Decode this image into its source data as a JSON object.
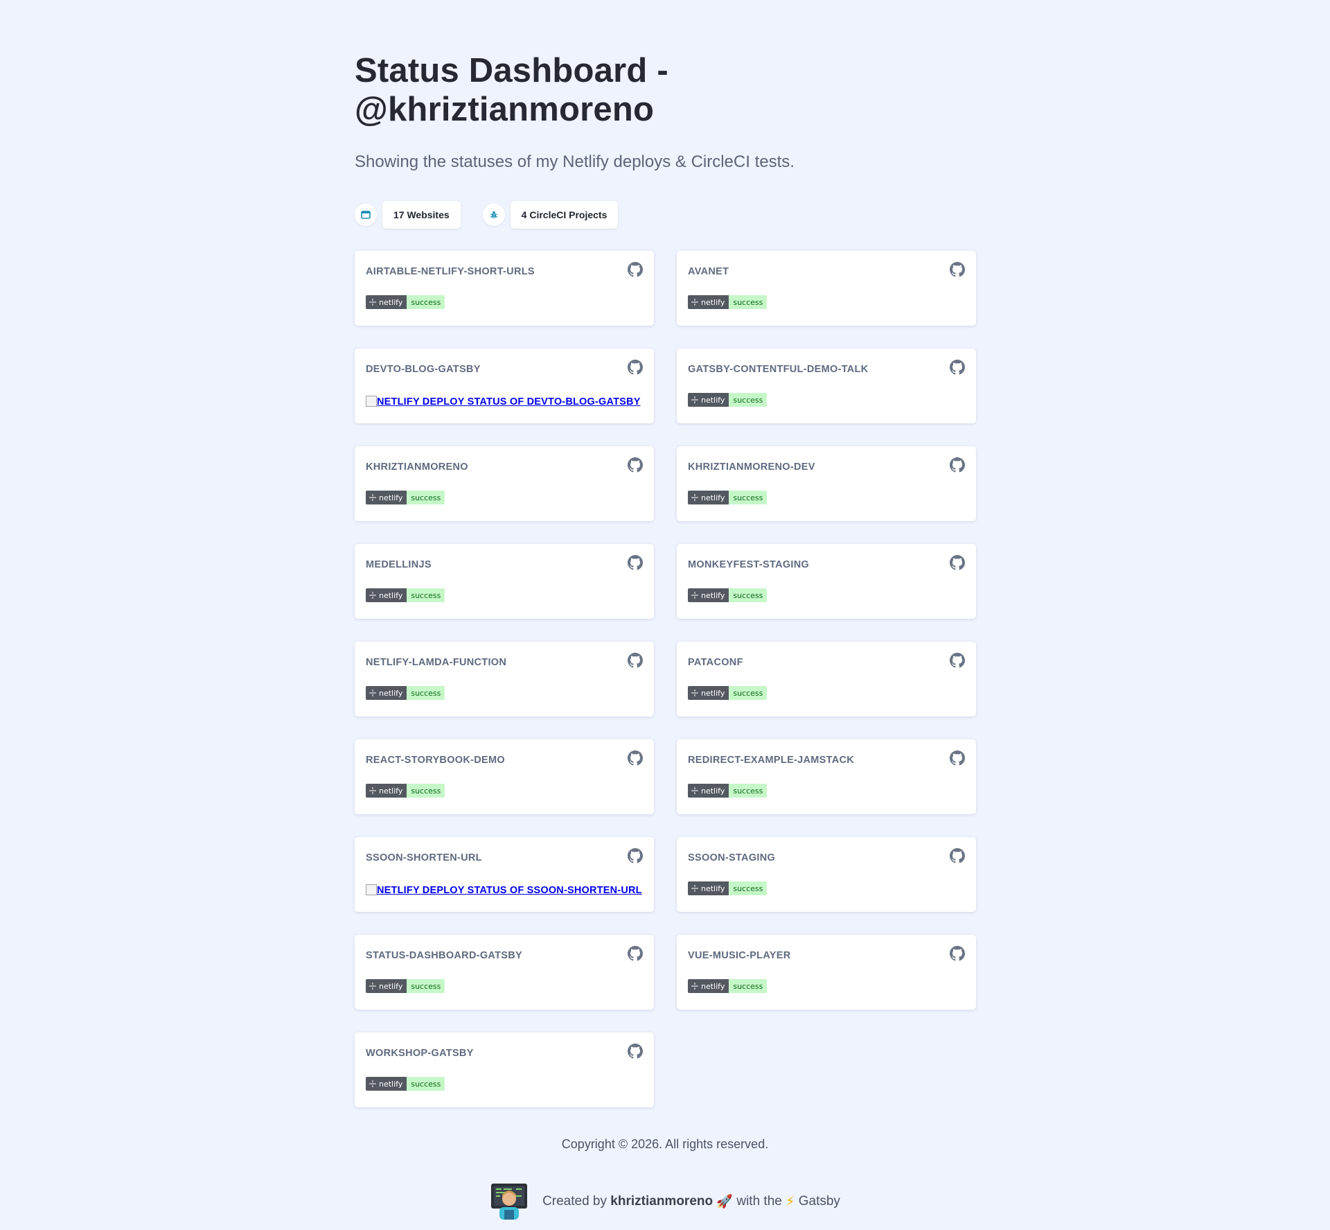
{
  "header": {
    "title": "Status Dashboard - @khriztianmoreno",
    "subtitle": "Showing the statuses of my Netlify deploys & CircleCI tests."
  },
  "stats": {
    "websites_label": "17 Websites",
    "circleci_label": "4 CircleCI Projects",
    "websites_icon": "browser-window-icon",
    "circleci_icon": "bug-icon"
  },
  "badge": {
    "left_label": "netlify",
    "right_label": "success"
  },
  "sites": [
    {
      "name": "AIRTABLE-NETLIFY-SHORT-URLS",
      "badge": true
    },
    {
      "name": "AVANET",
      "badge": true
    },
    {
      "name": "DEVTO-BLOG-GATSBY",
      "badge": false,
      "alt": "NETLIFY DEPLOY STATUS OF DEVTO-BLOG-GATSBY"
    },
    {
      "name": "GATSBY-CONTENTFUL-DEMO-TALK",
      "badge": true
    },
    {
      "name": "KHRIZTIANMORENO",
      "badge": true
    },
    {
      "name": "KHRIZTIANMORENO-DEV",
      "badge": true
    },
    {
      "name": "MEDELLINJS",
      "badge": true
    },
    {
      "name": "MONKEYFEST-STAGING",
      "badge": true
    },
    {
      "name": "NETLIFY-LAMDA-FUNCTION",
      "badge": true
    },
    {
      "name": "PATACONF",
      "badge": true
    },
    {
      "name": "REACT-STORYBOOK-DEMO",
      "badge": true
    },
    {
      "name": "REDIRECT-EXAMPLE-JAMSTACK",
      "badge": true
    },
    {
      "name": "SSOON-SHORTEN-URL",
      "badge": false,
      "alt": "NETLIFY DEPLOY STATUS OF SSOON-SHORTEN-URL"
    },
    {
      "name": "SSOON-STAGING",
      "badge": true
    },
    {
      "name": "STATUS-DASHBOARD-GATSBY",
      "badge": true
    },
    {
      "name": "VUE-MUSIC-PLAYER",
      "badge": true
    },
    {
      "name": "WORKSHOP-GATSBY",
      "badge": true
    }
  ],
  "footer": {
    "copyright": "Copyright © 2026. All rights reserved.",
    "created_prefix": "Created by",
    "author": "khriztianmoreno",
    "rocket": "🚀",
    "with_the": "with the",
    "bolt": "⚡",
    "framework": "Gatsby"
  },
  "colors": {
    "background": "#eff3fe",
    "badge_dark": "#545961",
    "badge_success_bg": "#c6f7c8",
    "badge_success_text": "#0c6b1a",
    "link": "#0000ee",
    "card_title": "#5f6a80"
  }
}
